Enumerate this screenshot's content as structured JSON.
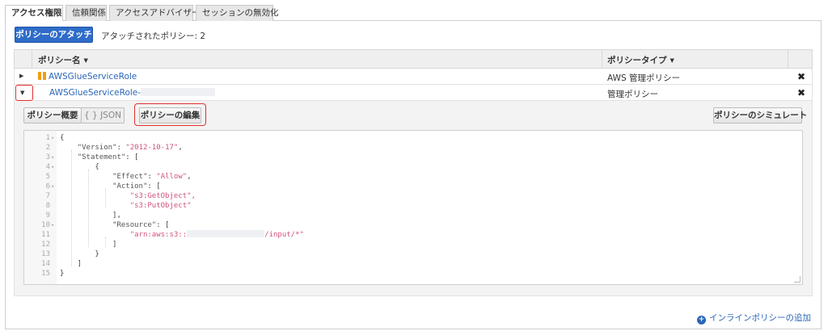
{
  "tabs": [
    {
      "label": "アクセス権限",
      "active": true
    },
    {
      "label": "信頼関係",
      "active": false
    },
    {
      "label": "アクセスアドバイザー",
      "active": false
    },
    {
      "label": "セッションの無効化",
      "active": false
    }
  ],
  "toolbar": {
    "attach_label": "ポリシーのアタッチ",
    "attached_count": "アタッチされたポリシー: 2"
  },
  "table": {
    "headers": {
      "name": "ポリシー名",
      "type": "ポリシータイプ"
    },
    "rows": [
      {
        "name": "AWSGlueServiceRole",
        "type": "AWS 管理ポリシー",
        "icon": "aws-managed-policy-icon"
      },
      {
        "name": "AWSGlueServiceRole-",
        "type": "管理ポリシー"
      }
    ]
  },
  "detail": {
    "summary_label": "ポリシー概要",
    "json_label": "{ } JSON",
    "edit_label": "ポリシーの編集",
    "simulate_label": "ポリシーのシミュレート"
  },
  "editor": {
    "lines": [
      {
        "n": "1",
        "fold": true,
        "code": "{"
      },
      {
        "n": "2",
        "fold": false,
        "code": "    \"Version\": \"2012-10-17\","
      },
      {
        "n": "3",
        "fold": true,
        "code": "    \"Statement\": ["
      },
      {
        "n": "4",
        "fold": true,
        "code": "        {"
      },
      {
        "n": "5",
        "fold": false,
        "code": "            \"Effect\": \"Allow\","
      },
      {
        "n": "6",
        "fold": true,
        "code": "            \"Action\": ["
      },
      {
        "n": "7",
        "fold": false,
        "code": "                \"s3:GetObject\","
      },
      {
        "n": "8",
        "fold": false,
        "code": "                \"s3:PutObject\""
      },
      {
        "n": "9",
        "fold": false,
        "code": "            ],"
      },
      {
        "n": "10",
        "fold": true,
        "code": "            \"Resource\": ["
      },
      {
        "n": "11",
        "fold": false,
        "code": "                \"arn:aws:s3::"
      },
      {
        "n": "12",
        "fold": false,
        "code": "            ]"
      },
      {
        "n": "13",
        "fold": false,
        "code": "        }"
      },
      {
        "n": "14",
        "fold": false,
        "code": "    ]"
      },
      {
        "n": "15",
        "fold": false,
        "code": "}"
      }
    ],
    "resource_suffix": "/input/*\""
  },
  "footer": {
    "inline_add_label": "インラインポリシーの追加"
  },
  "colors": {
    "accent": "#2e6cc8",
    "highlight": "#e0302f",
    "link": "#2a66b8"
  }
}
